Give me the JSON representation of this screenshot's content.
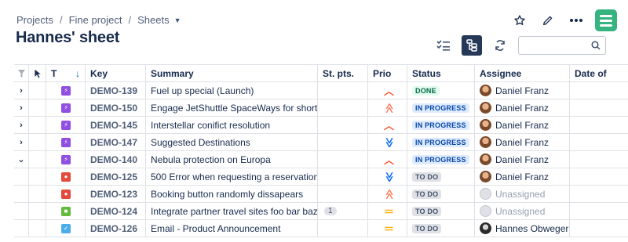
{
  "breadcrumb": {
    "projects": "Projects",
    "project": "Fine project",
    "sheets": "Sheets"
  },
  "page_title": "Hannes' sheet",
  "columns": {
    "type": "T",
    "key": "Key",
    "summary": "Summary",
    "story_points": "St. pts.",
    "priority": "Prio",
    "status": "Status",
    "assignee": "Assignee",
    "date": "Date of "
  },
  "rows": [
    {
      "key": "DEMO-139",
      "summary": "Fuel up special (Launch)",
      "points": "",
      "status": "DONE",
      "status_kind": "done",
      "assignee": "Daniel Franz",
      "avatar": "daniel",
      "type": "epic",
      "prio": "high",
      "expander": "›",
      "child": false
    },
    {
      "key": "DEMO-150",
      "summary": "Engage JetShuttle SpaceWays for short d...",
      "points": "",
      "status": "IN PROGRESS",
      "status_kind": "inprogress",
      "assignee": "Daniel Franz",
      "avatar": "daniel",
      "type": "epic",
      "prio": "highest",
      "expander": "›",
      "child": false
    },
    {
      "key": "DEMO-145",
      "summary": "Interstellar conifict resolution",
      "points": "",
      "status": "IN PROGRESS",
      "status_kind": "inprogress",
      "assignee": "Daniel Franz",
      "avatar": "daniel",
      "type": "epic",
      "prio": "high",
      "expander": "›",
      "child": false
    },
    {
      "key": "DEMO-147",
      "summary": "Suggested Destinations",
      "points": "",
      "status": "IN PROGRESS",
      "status_kind": "inprogress",
      "assignee": "Daniel Franz",
      "avatar": "daniel",
      "type": "epic",
      "prio": "lowest",
      "expander": "›",
      "child": false
    },
    {
      "key": "DEMO-140",
      "summary": "Nebula protection on Europa",
      "points": "",
      "status": "IN PROGRESS",
      "status_kind": "inprogress",
      "assignee": "Daniel Franz",
      "avatar": "daniel",
      "type": "epic",
      "prio": "high",
      "expander": "⌄",
      "child": false
    },
    {
      "key": "DEMO-125",
      "summary": "500 Error when requesting a reservation",
      "points": "",
      "status": "TO DO",
      "status_kind": "todo",
      "assignee": "Daniel Franz",
      "avatar": "daniel",
      "type": "bug",
      "prio": "lowest",
      "expander": "",
      "child": true
    },
    {
      "key": "DEMO-123",
      "summary": "Booking button randomly dissapears",
      "points": "",
      "status": "TO DO",
      "status_kind": "todo",
      "assignee": "Unassigned",
      "avatar": "none",
      "type": "bug",
      "prio": "highest",
      "expander": "",
      "child": true
    },
    {
      "key": "DEMO-124",
      "summary": "Integrate partner travel sites foo bar baz",
      "points": "1",
      "status": "TO DO",
      "status_kind": "todo",
      "assignee": "Unassigned",
      "avatar": "none",
      "type": "story",
      "prio": "medium",
      "expander": "",
      "child": true
    },
    {
      "key": "DEMO-126",
      "summary": "Email - Product Announcement",
      "points": "",
      "status": "TO DO",
      "status_kind": "todo",
      "assignee": "Hannes Obweger",
      "avatar": "hannes",
      "type": "task",
      "prio": "medium",
      "expander": "",
      "child": true
    }
  ],
  "icons": {
    "star": "star-icon",
    "edit": "pencil-icon",
    "more": "more-icon",
    "logo": "app-logo",
    "search": "search-icon"
  },
  "colors": {
    "prio_high": "#ff5630",
    "prio_highest": "#ff7452",
    "prio_medium": "#ffab00",
    "prio_lowest": "#0065ff"
  }
}
